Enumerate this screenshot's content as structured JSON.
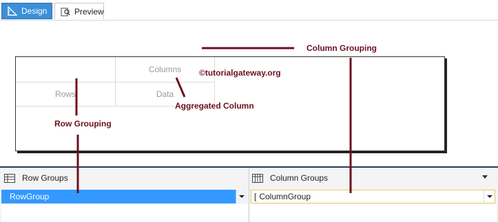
{
  "tabs": [
    {
      "label": "Design",
      "icon": "design-icon",
      "active": true
    },
    {
      "label": "Preview",
      "icon": "preview-icon",
      "active": false
    }
  ],
  "tablix": {
    "columns_label": "Columns",
    "rows_label": "Rows",
    "data_label": "Data"
  },
  "annotations": {
    "column_grouping": "Column Grouping",
    "watermark": "©tutorialgateway.org",
    "aggregated_column": "Aggregated Column",
    "row_grouping": "Row Grouping",
    "color": "#6b0f1f"
  },
  "grouping_pane": {
    "row_groups_title": "Row Groups",
    "column_groups_title": "Column Groups",
    "row_group_item": "RowGroup",
    "column_group_prefix": "[",
    "column_group_item": "ColumnGroup",
    "selected_color": "#3399ff"
  }
}
